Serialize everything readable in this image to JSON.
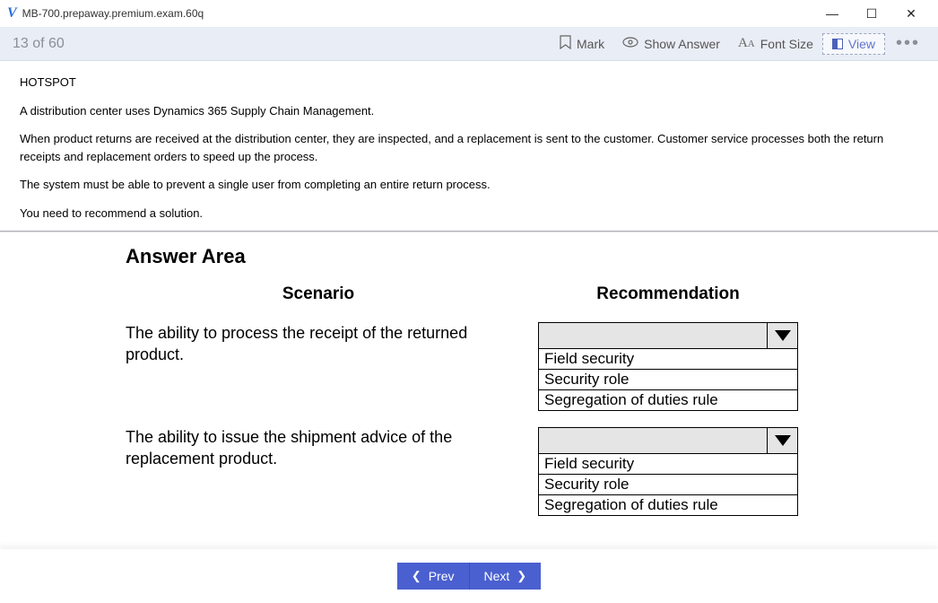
{
  "window": {
    "title": "MB-700.prepaway.premium.exam.60q"
  },
  "toolbar": {
    "progress": "13 of 60",
    "mark": "Mark",
    "show_answer": "Show Answer",
    "font_size": "Font Size",
    "view": "View"
  },
  "question": {
    "label": "HOTSPOT",
    "p1": "A distribution center uses Dynamics 365 Supply Chain Management.",
    "p2": "When product returns are received at the distribution center, they are inspected, and a replacement is sent to the customer. Customer service processes both the return receipts and replacement orders to speed up the process.",
    "p3": "The system must be able to prevent a single user from completing an entire return process.",
    "p4": "You need to recommend a solution."
  },
  "answer_area": {
    "title": "Answer Area",
    "scenario_heading": "Scenario",
    "recommendation_heading": "Recommendation",
    "rows": [
      {
        "scenario": "The ability to process the receipt of the returned product.",
        "options": [
          "Field security",
          "Security role",
          "Segregation of duties rule"
        ]
      },
      {
        "scenario": "The ability to issue the shipment advice of the replacement product.",
        "options": [
          "Field security",
          "Security role",
          "Segregation of duties rule"
        ]
      }
    ]
  },
  "footer": {
    "prev": "Prev",
    "next": "Next"
  }
}
